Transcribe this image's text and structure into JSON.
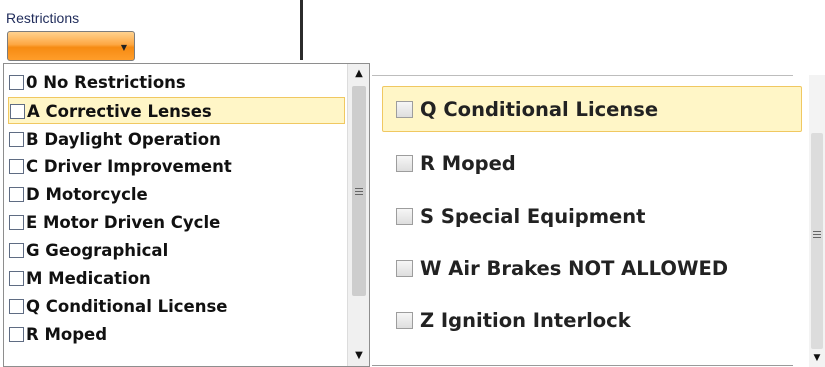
{
  "field": {
    "label": "Restrictions",
    "selected_value": ""
  },
  "dropdown_list": {
    "items": [
      {
        "label": "0 No Restrictions",
        "highlighted": false
      },
      {
        "label": "A Corrective Lenses",
        "highlighted": true
      },
      {
        "label": "B Daylight Operation",
        "highlighted": false
      },
      {
        "label": "C Driver Improvement",
        "highlighted": false
      },
      {
        "label": "D Motorcycle",
        "highlighted": false
      },
      {
        "label": "E Motor Driven Cycle",
        "highlighted": false
      },
      {
        "label": "G Geographical",
        "highlighted": false
      },
      {
        "label": "M Medication",
        "highlighted": false
      },
      {
        "label": "Q Conditional License",
        "highlighted": false
      },
      {
        "label": "R Moped",
        "highlighted": false
      }
    ]
  },
  "zoomed_list": {
    "items": [
      {
        "label": "Q Conditional License",
        "highlighted": true
      },
      {
        "label": "R Moped",
        "highlighted": false
      },
      {
        "label": "S Special Equipment",
        "highlighted": false
      },
      {
        "label": "W Air Brakes NOT ALLOWED",
        "highlighted": false
      },
      {
        "label": "Z Ignition Interlock",
        "highlighted": false
      }
    ]
  },
  "icons": {
    "dropdown_arrow": "chevron-down-icon",
    "scroll_up": "scroll-up-arrow-icon",
    "scroll_down": "scroll-down-arrow-icon"
  },
  "colors": {
    "dropdown_orange": "#f68b12",
    "highlight_bg": "#fff6c7",
    "highlight_border": "#f0c861"
  }
}
